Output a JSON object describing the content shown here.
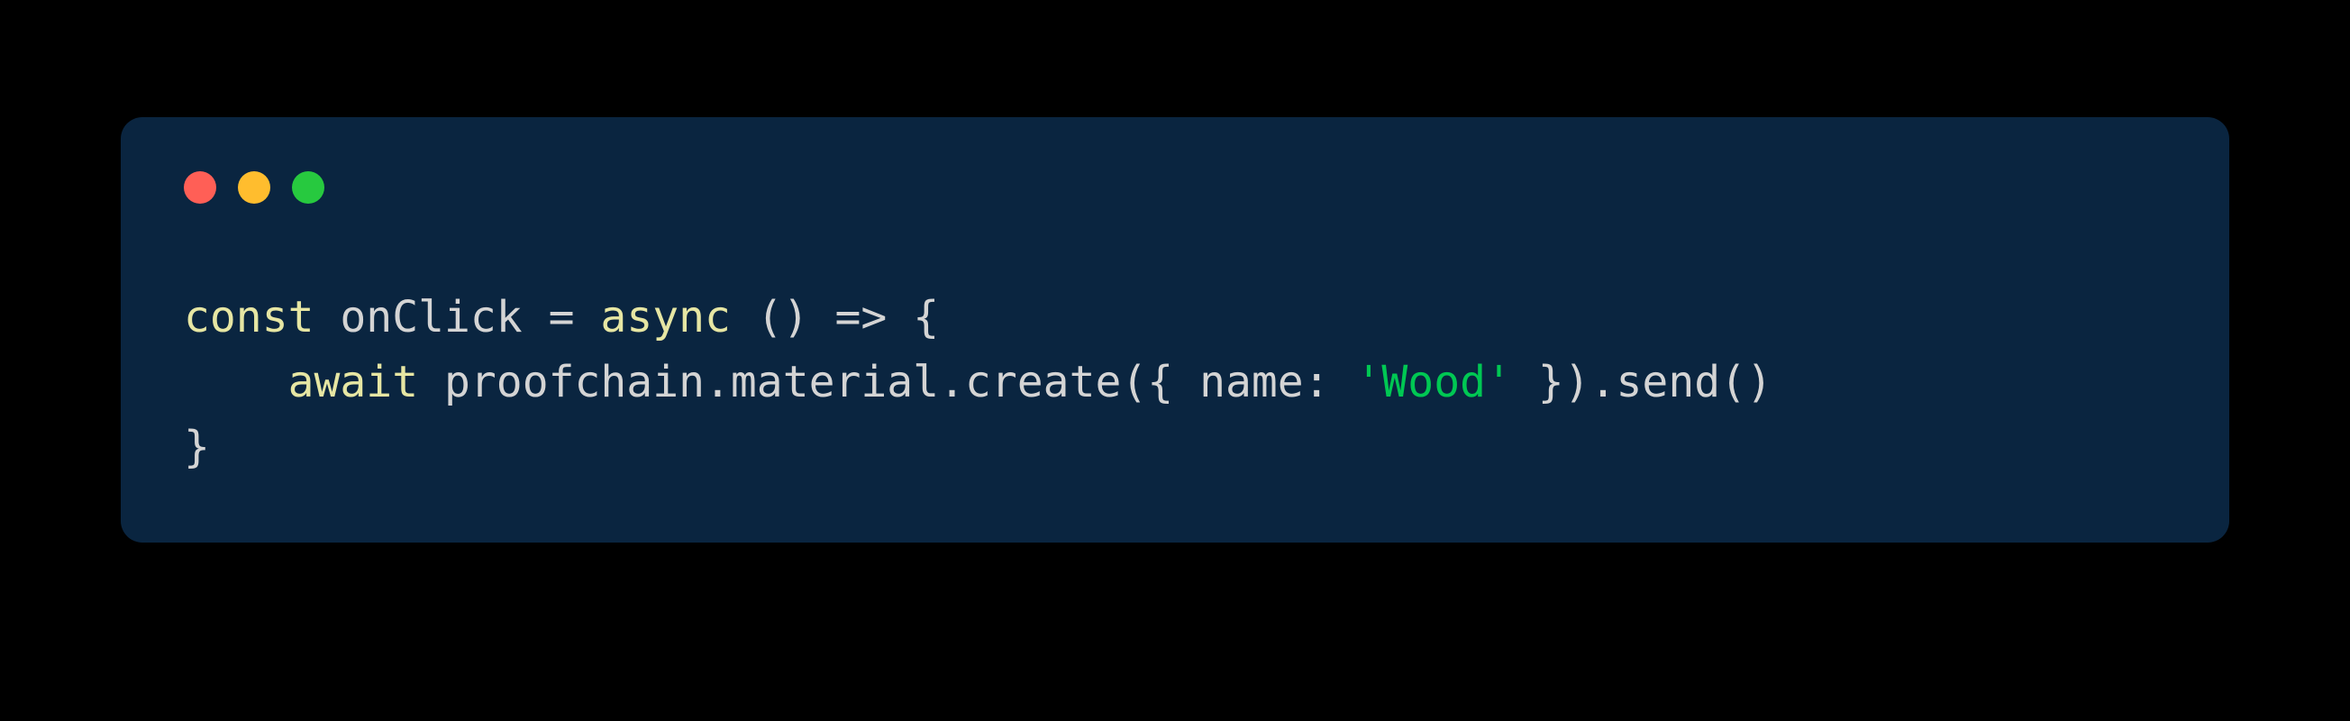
{
  "window": {
    "controls": {
      "close": "close",
      "minimize": "minimize",
      "maximize": "maximize"
    }
  },
  "code": {
    "line1": {
      "const": "const",
      "variable": "onClick",
      "equals": "=",
      "async": "async",
      "parens": "()",
      "arrow": "=>",
      "openBrace": "{"
    },
    "line2": {
      "indent": "    ",
      "await": "await",
      "object": "proofchain",
      "dot1": ".",
      "property": "material",
      "dot2": ".",
      "method1": "create",
      "openParen1": "(",
      "openBrace": "{",
      "propName": "name",
      "colon": ":",
      "string": "'Wood'",
      "closeBrace": "}",
      "closeParen1": ")",
      "dot3": ".",
      "method2": "send",
      "openParen2": "(",
      "closeParen2": ")"
    },
    "line3": {
      "closeBrace": "}"
    }
  }
}
